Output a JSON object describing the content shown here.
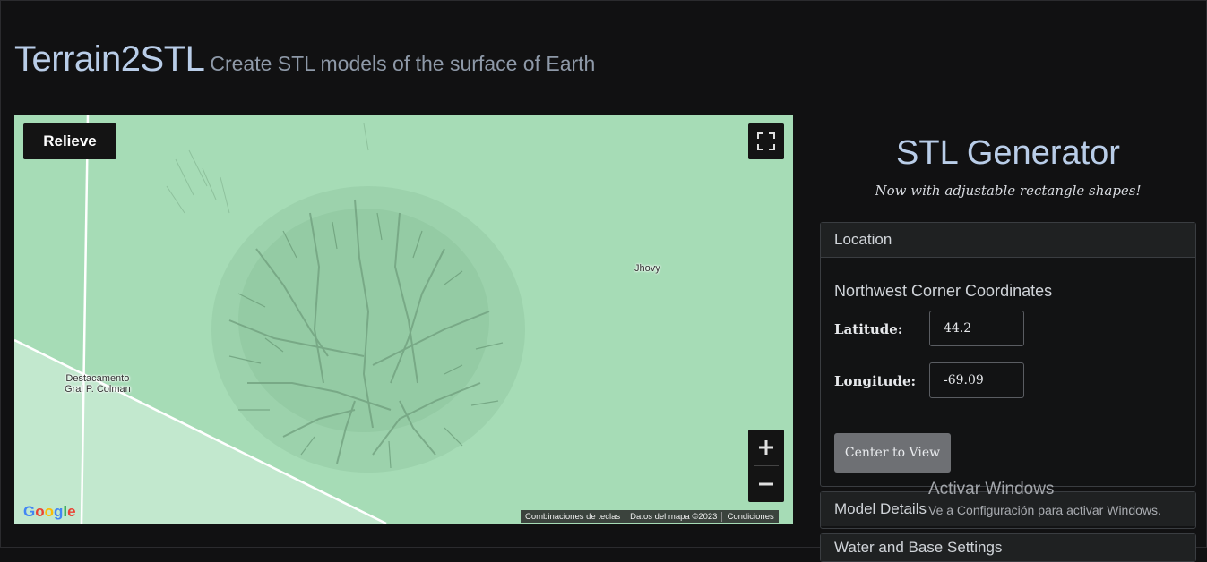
{
  "header": {
    "brand": "Terrain2STL",
    "tagline": "Create STL models of the surface of Earth"
  },
  "map": {
    "map_type_button": "Relieve",
    "labels": {
      "town_right": "Jhovy",
      "town_left_line1": "Destacamento",
      "town_left_line2": "Gral P. Colman"
    },
    "google_logo": "Google",
    "attribution": {
      "shortcuts": "Combinaciones de teclas",
      "map_data": "Datos del mapa ©2023",
      "terms": "Condiciones"
    },
    "zoom_in_symbol": "+",
    "zoom_out_symbol": "−",
    "colors": {
      "terrain": "#a6dcb6",
      "road": "#ffffff"
    }
  },
  "generator": {
    "title": "STL Generator",
    "subtitle": "Now with adjustable rectangle shapes!"
  },
  "location": {
    "heading": "Location",
    "subheading": "Northwest Corner Coordinates",
    "latitude_label": "Latitude:",
    "latitude_value": "44.2",
    "longitude_label": "Longitude:",
    "longitude_value": "-69.09",
    "center_button": "Center to View"
  },
  "model_details": {
    "heading": "Model Details"
  },
  "next_section": {
    "heading": "Water and Base Settings"
  },
  "windows_watermark": {
    "title": "Activar Windows",
    "message": "Ve a Configuración para activar Windows."
  }
}
